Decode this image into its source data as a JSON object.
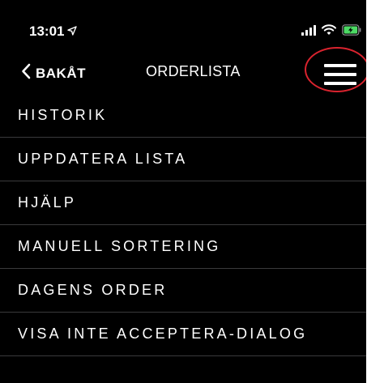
{
  "status_bar": {
    "time": "13:01",
    "location_icon": "location-arrow-icon",
    "signal_icon": "cellular-signal-icon",
    "wifi_icon": "wifi-icon",
    "battery_icon": "battery-charging-icon",
    "battery_color": "#4cd964"
  },
  "nav": {
    "back_label": "BAKÅT",
    "title": "ORDERLISTA",
    "menu_icon": "hamburger-menu-icon"
  },
  "menu": {
    "items": [
      {
        "label": "HISTORIK"
      },
      {
        "label": "UPPDATERA LISTA"
      },
      {
        "label": "HJÄLP"
      },
      {
        "label": "MANUELL SORTERING"
      },
      {
        "label": "DAGENS ORDER"
      },
      {
        "label": "VISA INTE ACCEPTERA-DIALOG"
      }
    ]
  },
  "colors": {
    "background": "#000000",
    "text": "#ffffff",
    "divider": "#3a3a3c",
    "highlight_ring": "#d9232e"
  }
}
